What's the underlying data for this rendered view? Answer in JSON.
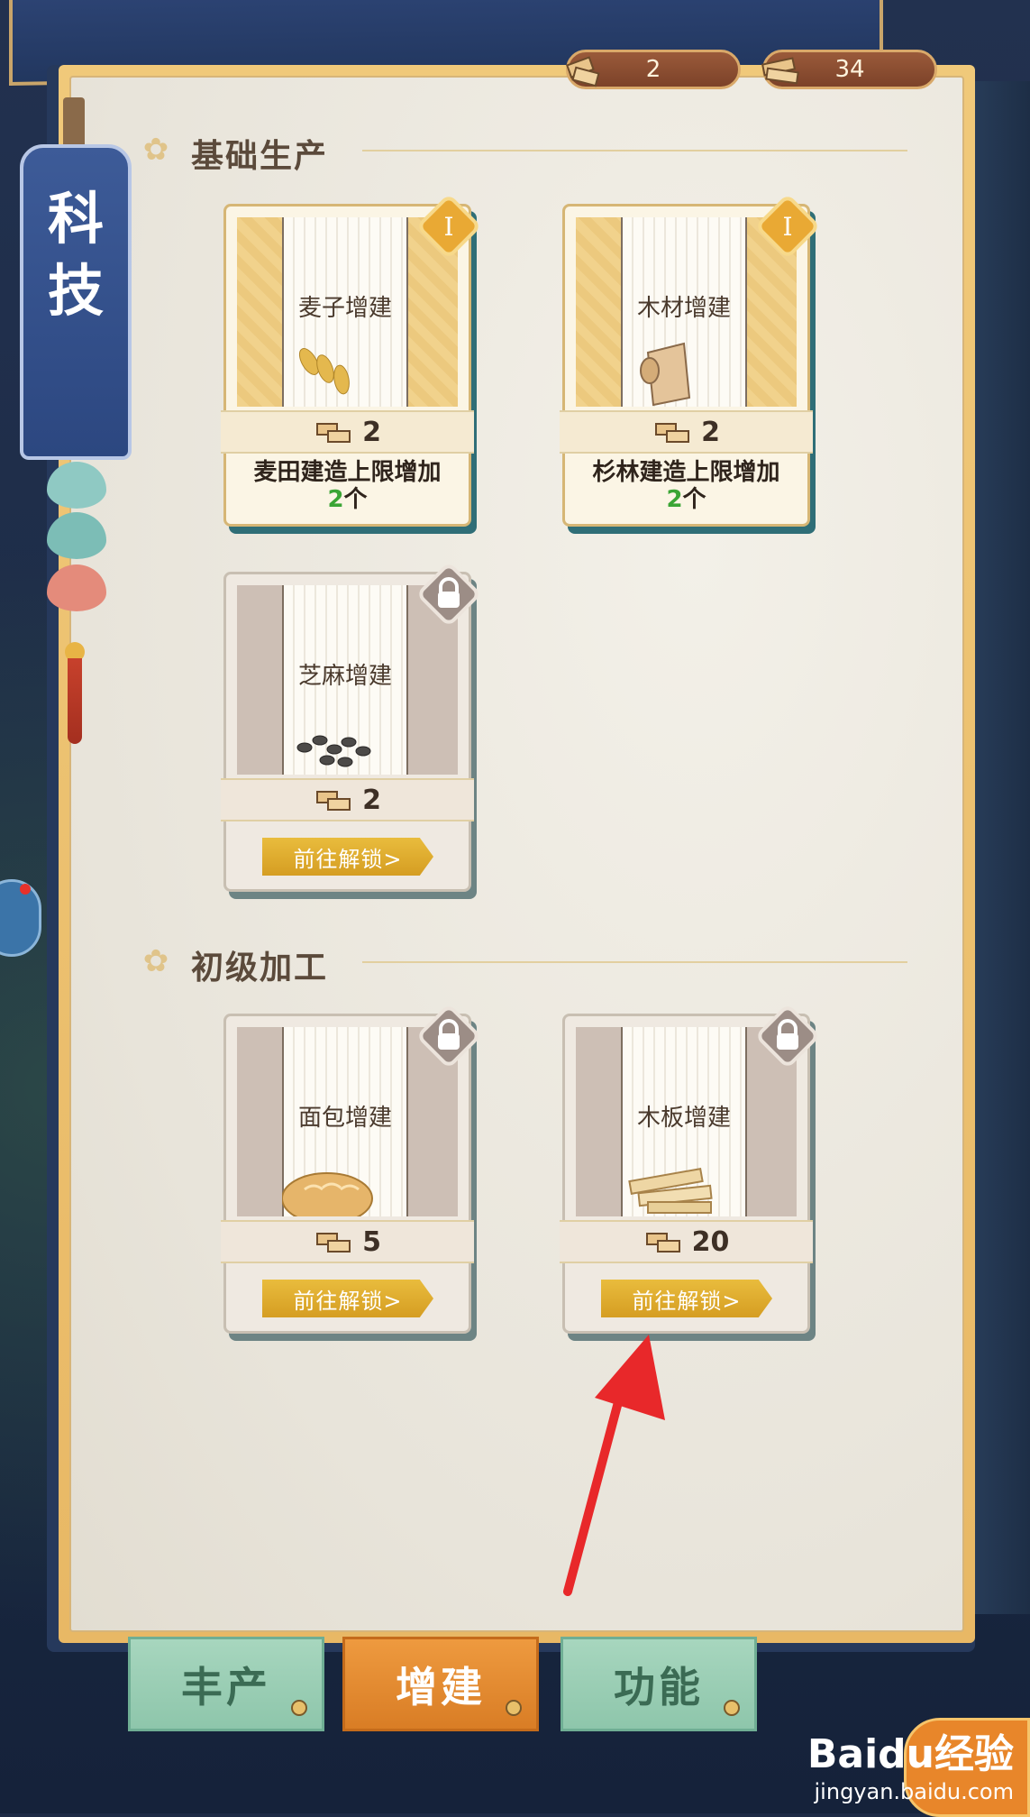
{
  "currency": [
    {
      "name": "wood-blocks",
      "value": "2"
    },
    {
      "name": "wood-planks",
      "value": "34"
    }
  ],
  "banner": {
    "char1": "科",
    "char2": "技"
  },
  "sections": [
    {
      "title": "基础生产"
    },
    {
      "title": "初级加工"
    }
  ],
  "cards": [
    {
      "scroll_title": "麦子增建",
      "cost": "2",
      "desc_main": "麦田建造上限增加",
      "desc_num": "2",
      "desc_unit": "个",
      "level": "Ⅰ",
      "state": "unlocked",
      "art": "wheat"
    },
    {
      "scroll_title": "木材增建",
      "cost": "2",
      "desc_main": "杉林建造上限增加",
      "desc_num": "2",
      "desc_unit": "个",
      "level": "Ⅰ",
      "state": "unlocked",
      "art": "wood"
    },
    {
      "scroll_title": "芝麻增建",
      "cost": "2",
      "button": "前往解锁>",
      "state": "locked",
      "art": "sesame"
    },
    {
      "scroll_title": "面包增建",
      "cost": "5",
      "button": "前往解锁>",
      "state": "locked",
      "art": "bread"
    },
    {
      "scroll_title": "木板增建",
      "cost": "20",
      "button": "前往解锁>",
      "state": "locked",
      "art": "planks"
    }
  ],
  "tabs": [
    {
      "label": "丰产",
      "active": false
    },
    {
      "label": "增建",
      "active": true
    },
    {
      "label": "功能",
      "active": false
    }
  ],
  "watermark": {
    "logo": "Baidu经验",
    "url": "jingyan.baidu.com"
  },
  "colors": {
    "accent_gold": "#e0b24a",
    "tab_active": "#e08a30",
    "tab_inactive": "#9ccfb5",
    "highlight_green": "#3aa535"
  }
}
